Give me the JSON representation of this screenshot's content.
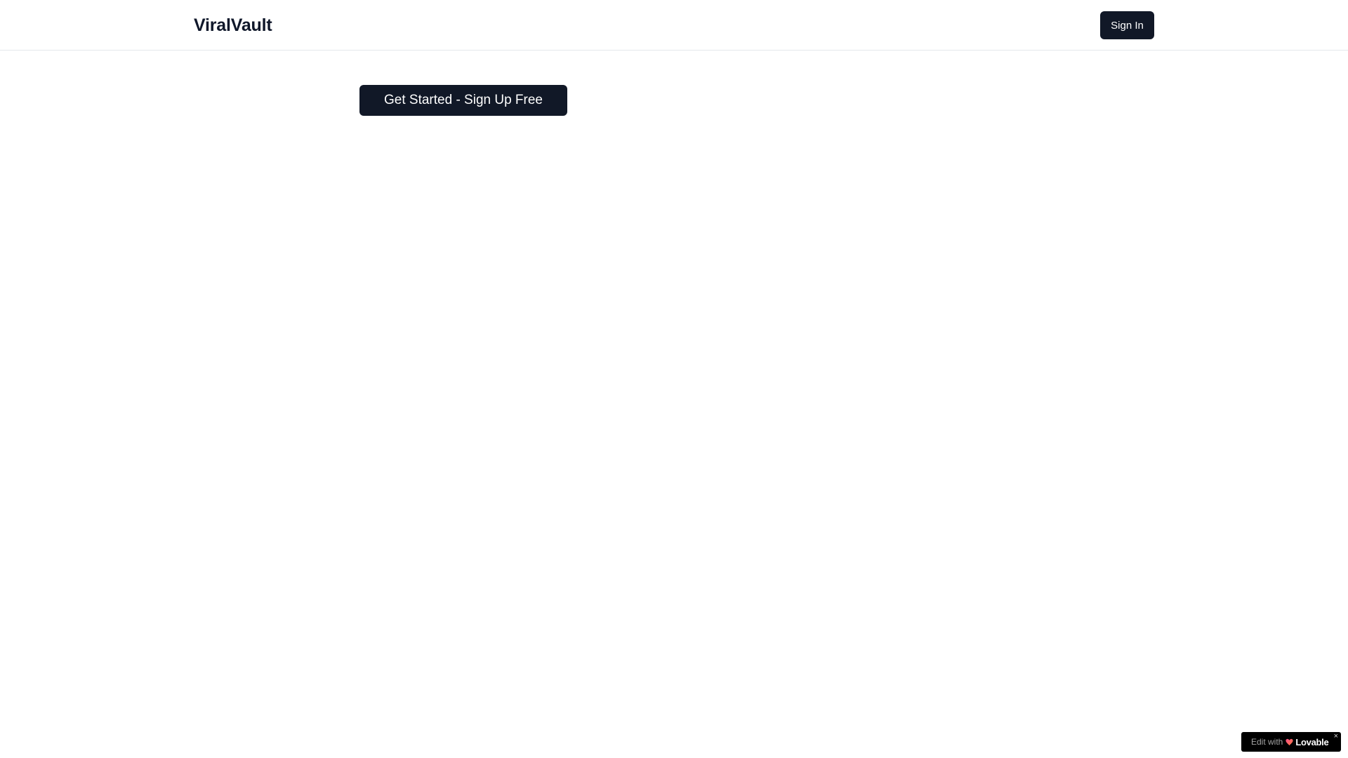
{
  "header": {
    "logo_text": "ViralVault",
    "signin_label": "Sign In"
  },
  "hero": {
    "cta_label": "Get Started - Sign Up Free"
  },
  "badge": {
    "prefix": "Edit with",
    "brand": "Lovable",
    "close": "×"
  },
  "colors": {
    "primary": "#111827",
    "text": "#0f172a",
    "border": "#e5e7eb",
    "background": "#ffffff",
    "badge_bg": "#000000",
    "lovable_gradient_start": "#ff4f8b",
    "lovable_gradient_end": "#ff7a3d"
  },
  "icons": {
    "lovable_logo": "heart-icon",
    "badge_close": "close-icon"
  }
}
